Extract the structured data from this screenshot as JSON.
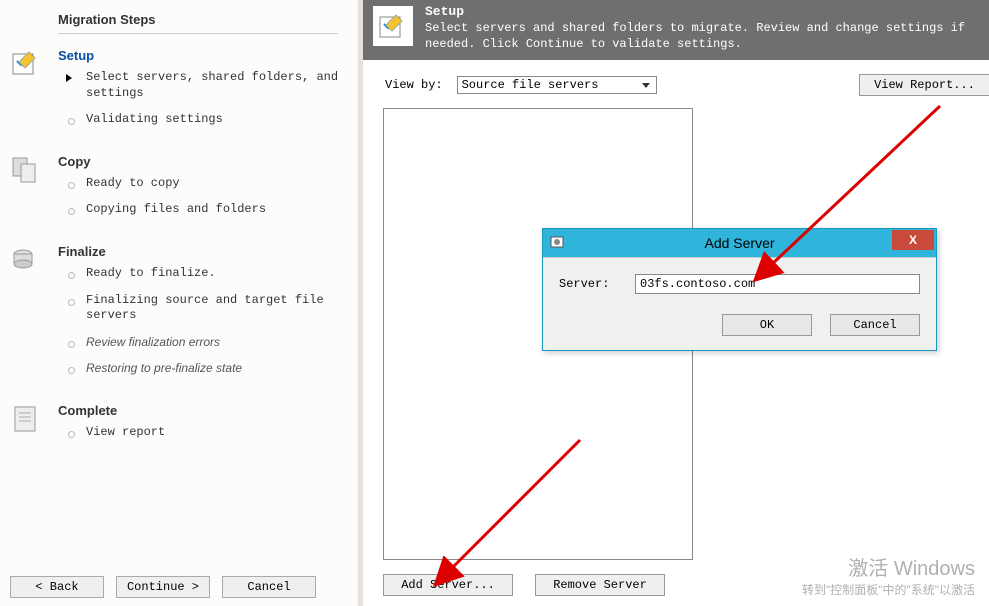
{
  "left": {
    "title": "Migration Steps",
    "setup": {
      "heading": "Setup",
      "step1": "Select servers, shared folders, and settings",
      "step2": "Validating settings"
    },
    "copy": {
      "heading": "Copy",
      "step1": "Ready to copy",
      "step2": "Copying files and folders"
    },
    "finalize": {
      "heading": "Finalize",
      "step1": "Ready to finalize.",
      "step2": "Finalizing source and target file servers",
      "step3": "Review finalization errors",
      "step4": "Restoring to pre-finalize state"
    },
    "complete": {
      "heading": "Complete",
      "step1": "View report"
    },
    "buttons": {
      "back": "< Back",
      "continue": "Continue >",
      "cancel": "Cancel"
    }
  },
  "header": {
    "title": "Setup",
    "desc": "Select servers and shared folders to migrate. Review and change settings if needed. Click Continue to validate settings."
  },
  "main": {
    "viewby_label": "View by:",
    "viewby_value": "Source file servers",
    "view_report": "View Report...",
    "add_server": "Add Server...",
    "remove_server": "Remove Server"
  },
  "dialog": {
    "title": "Add Server",
    "server_label": "Server:",
    "server_value": "03fs.contoso.com",
    "ok": "OK",
    "cancel": "Cancel",
    "close": "X"
  },
  "watermark": {
    "line1": "激活 Windows",
    "line2": "转到\"控制面板\"中的\"系统\"以激活"
  }
}
